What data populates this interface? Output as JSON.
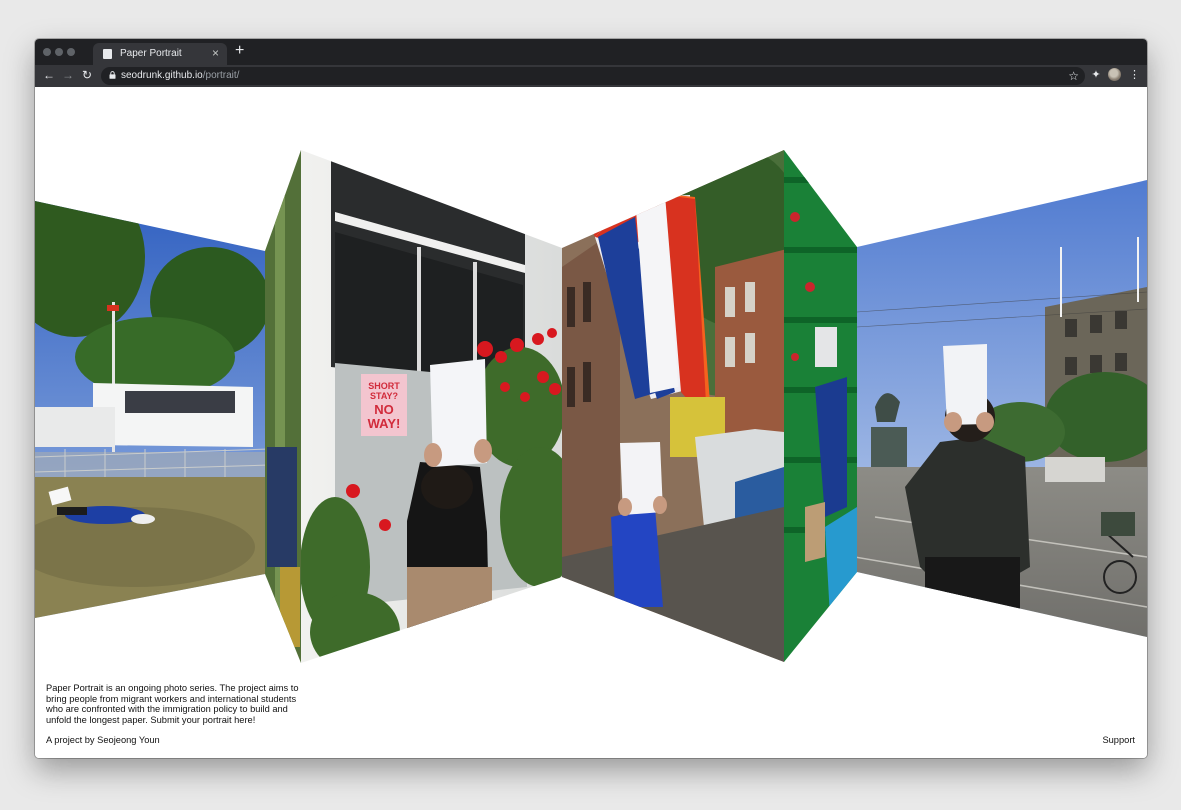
{
  "browser": {
    "tab_title": "Paper Portrait",
    "tab_close": "×",
    "new_tab": "+",
    "url_host": "seodrunk.github.io",
    "url_path": "/portrait/",
    "icons": [
      "back-icon",
      "forward-icon",
      "reload-icon",
      "lock-icon",
      "star-icon",
      "extensions-icon",
      "profile-avatar",
      "menu-icon"
    ]
  },
  "page": {
    "intro": "Paper Portrait is an ongoing photo series. The project aims to bring people from migrant workers and international students who are confronted with the immigration policy to build and unfold the longest paper. Submit your portrait here!",
    "credit": "A project by Seojeong Youn",
    "support_link": "Support"
  },
  "photos": [
    {
      "scene": "person lying on grass covering face with paper, white cabin behind fence"
    },
    {
      "scene": "person in black holding paper in front of white window with red roses",
      "sign_line1": "SHORT",
      "sign_line2": "STAY?",
      "sign_line3": "NO",
      "sign_line4": "WAY!"
    },
    {
      "scene": "person in blue sweater holding paper on street with Dutch flag"
    },
    {
      "scene": "person in front of green beer crates holding paper"
    },
    {
      "scene": "person in dark jacket holding paper on city square with statue"
    }
  ],
  "colors": {
    "sky": "#4a78c8",
    "flag_red": "#d8321f",
    "flag_blue": "#1d3f9a",
    "page_bg": "#ffffff",
    "chrome_dark": "#202124"
  }
}
